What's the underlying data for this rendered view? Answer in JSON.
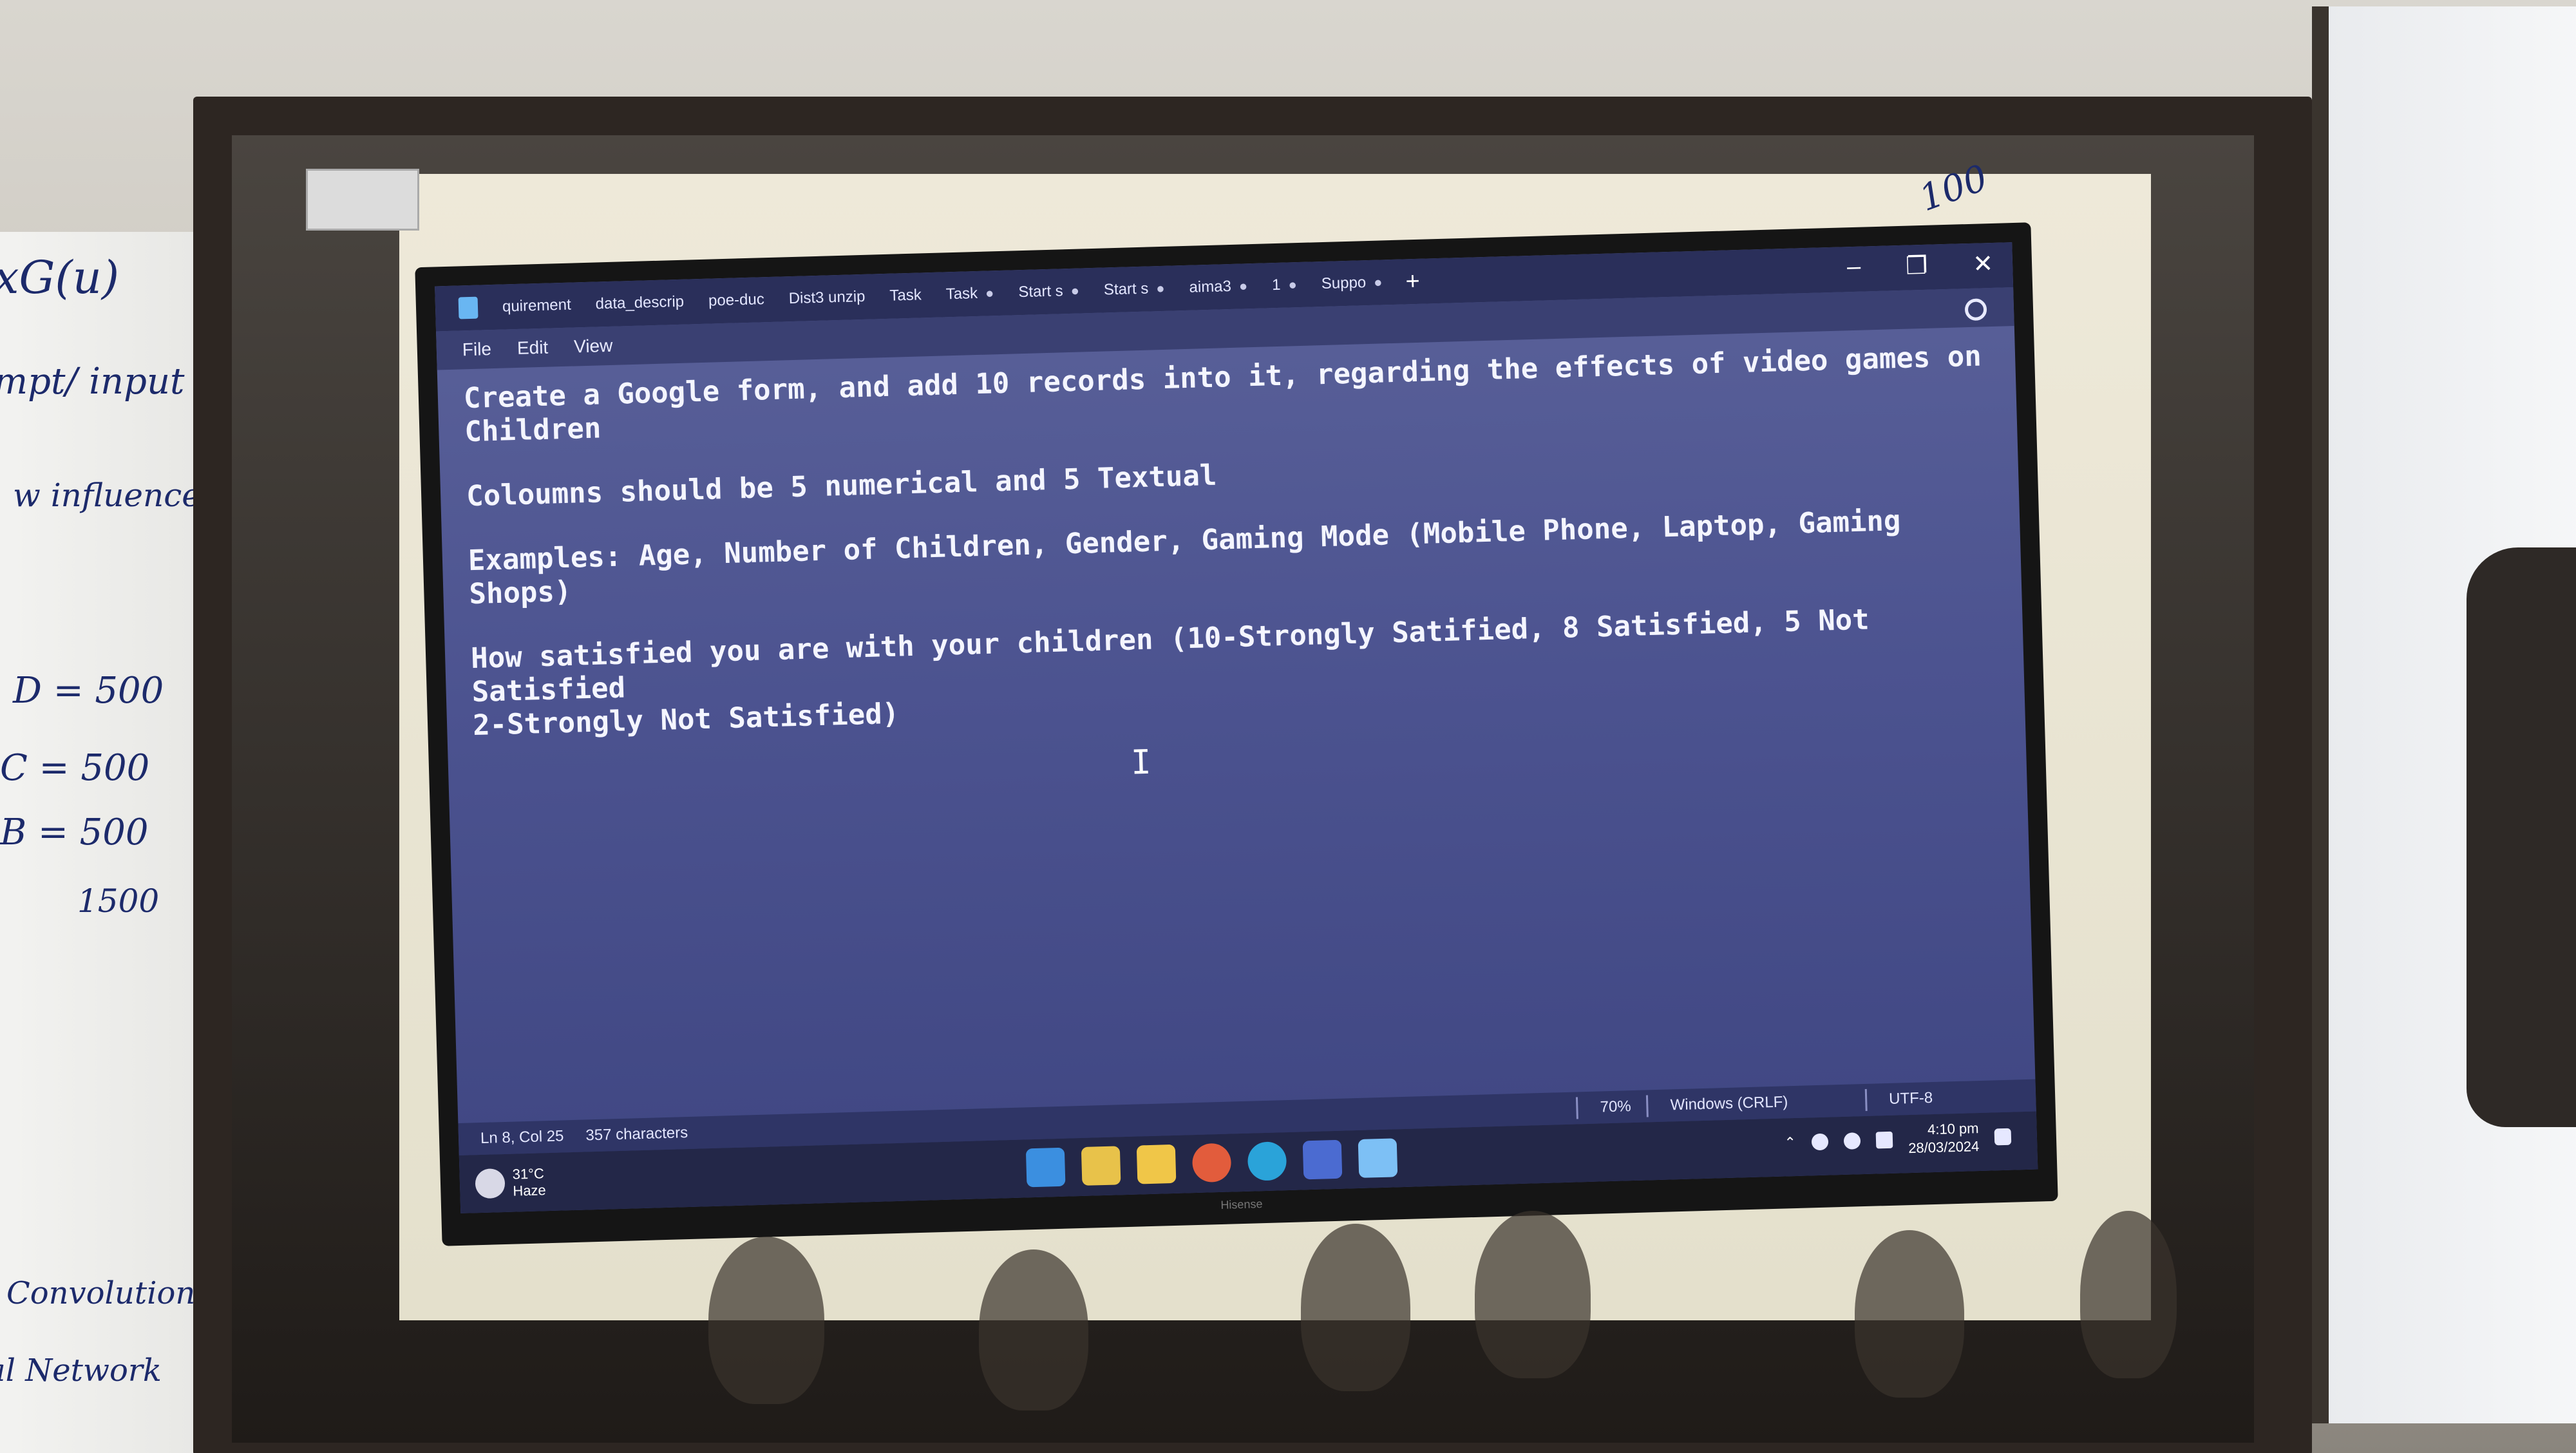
{
  "whiteboard_left": {
    "lines": [
      "xG(u)",
      "mpt/ input",
      "w influence",
      "D = 500",
      "C = 500",
      "B = 500",
      "1500",
      "Convolution",
      "al Network"
    ]
  },
  "whiteboard_right": {
    "lines": [
      "100"
    ]
  },
  "notepad": {
    "tabs": [
      "quirement",
      "data_descrip",
      "poe-duc",
      "Dist3 unzip",
      "Task",
      "Task",
      "Start s",
      "Start s",
      "aima3",
      "1",
      "Suppo"
    ],
    "menu": [
      "File",
      "Edit",
      "View"
    ],
    "content": {
      "line1": "Create a Google form, and add 10 records into it, regarding the effects of video games on Children",
      "line2": "Coloumns should be 5 numerical and 5 Textual",
      "line3": "Examples: Age, Number of Children, Gender, Gaming Mode (Mobile Phone, Laptop, Gaming Shops)",
      "line4": "How satisfied you are with your children (10-Strongly Satified, 8 Satisfied, 5 Not Satisfied\n2-Strongly Not Satisfied)"
    },
    "status": {
      "position": "Ln 8, Col 25",
      "characters": "357 characters",
      "zoom": "70%",
      "line_ending": "Windows (CRLF)",
      "encoding": "UTF-8"
    }
  },
  "taskbar": {
    "weather_temp": "31°C",
    "weather_desc": "Haze",
    "time": "4:10 pm",
    "date": "28/03/2024"
  },
  "tv_brand": "Hisense",
  "colors": {
    "screen_bg": "#4c5390",
    "text": "#f4f5ff",
    "taskbar": "#232748"
  }
}
